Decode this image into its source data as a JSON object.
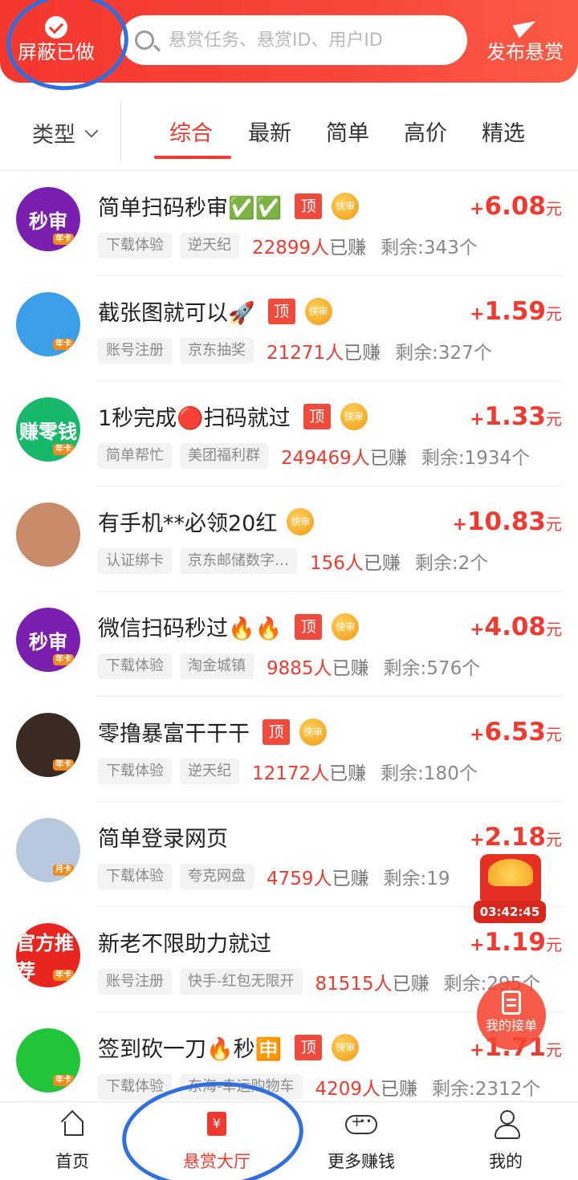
{
  "header": {
    "hide_done_label": "屏蔽已做",
    "search_placeholder": "悬赏任务、悬赏ID、用户ID",
    "publish_label": "发布悬赏"
  },
  "filters": {
    "type_label": "类型",
    "tabs": [
      "综合",
      "最新",
      "简单",
      "高价",
      "精选"
    ],
    "active_tab": "综合"
  },
  "badges": {
    "top": "顶",
    "fast": "快审",
    "unit": "元",
    "plus": "+"
  },
  "tasks": [
    {
      "title": "简单扫码秒审✅✅",
      "top": true,
      "fast": true,
      "price": "6.08",
      "tags": [
        "下载体验",
        "逆天纪"
      ],
      "earned_num": "22899人",
      "earned_txt": "已赚",
      "remaining": "剩余:343个",
      "avatar_text": "秒审",
      "avatar_color": "#7a1fb0",
      "card": "年卡"
    },
    {
      "title": "截张图就可以🚀",
      "top": true,
      "fast": true,
      "price": "1.59",
      "tags": [
        "账号注册",
        "京东抽奖"
      ],
      "earned_num": "21271人",
      "earned_txt": "已赚",
      "remaining": "剩余:327个",
      "avatar_text": "",
      "avatar_color": "#3a9ee8",
      "card": "年卡"
    },
    {
      "title": "1秒完成🔴扫码就过",
      "top": true,
      "fast": true,
      "price": "1.33",
      "tags": [
        "简单帮忙",
        "美团福利群"
      ],
      "earned_num": "249469人",
      "earned_txt": "已赚",
      "remaining": "剩余:1934个",
      "avatar_text": "赚零钱",
      "avatar_color": "#17b86a",
      "card": "年卡"
    },
    {
      "title": "有手机**必领20红",
      "top": false,
      "fast": true,
      "price": "10.83",
      "tags": [
        "认证绑卡",
        "京东邮储数字…"
      ],
      "earned_num": "156人",
      "earned_txt": "已赚",
      "remaining": "剩余:2个",
      "avatar_text": "",
      "avatar_color": "#c98a6a",
      "card": ""
    },
    {
      "title": "微信扫码秒过🔥🔥",
      "top": true,
      "fast": true,
      "price": "4.08",
      "tags": [
        "下载体验",
        "淘金城镇"
      ],
      "earned_num": "9885人",
      "earned_txt": "已赚",
      "remaining": "剩余:576个",
      "avatar_text": "秒审",
      "avatar_color": "#7a1fb0",
      "card": "年卡"
    },
    {
      "title": "零撸暴富干干干",
      "top": true,
      "fast": true,
      "price": "6.53",
      "tags": [
        "下载体验",
        "逆天纪"
      ],
      "earned_num": "12172人",
      "earned_txt": "已赚",
      "remaining": "剩余:180个",
      "avatar_text": "",
      "avatar_color": "#3b2a22",
      "card": "年卡"
    },
    {
      "title": "简单登录网页",
      "top": false,
      "fast": false,
      "price": "2.18",
      "tags": [
        "下载体验",
        "夸克网盘"
      ],
      "earned_num": "4759人",
      "earned_txt": "已赚",
      "remaining": "剩余:19",
      "avatar_text": "",
      "avatar_color": "#b9c9dd",
      "card": "月卡"
    },
    {
      "title": "新老不限助力就过",
      "top": false,
      "fast": false,
      "price": "1.19",
      "tags": [
        "账号注册",
        "快手-红包无限开"
      ],
      "earned_num": "81515人",
      "earned_txt": "已赚",
      "remaining": "剩余:295个",
      "avatar_text": "官方推荐",
      "avatar_color": "#e8261f",
      "card": "年卡"
    },
    {
      "title": "签到砍一刀🔥秒🈸",
      "top": true,
      "fast": true,
      "price": "1.71",
      "tags": [
        "下载体验",
        "东海-幸运购物车"
      ],
      "earned_num": "4209人",
      "earned_txt": "已赚",
      "remaining": "剩余:2312个",
      "avatar_text": "",
      "avatar_color": "#22c43a",
      "card": "年卡"
    }
  ],
  "floating": {
    "countdown": "03:42:45",
    "my_orders_label": "我的接单"
  },
  "nav": {
    "items": [
      "首页",
      "悬赏大厅",
      "更多赚钱",
      "我的"
    ],
    "active": "悬赏大厅",
    "hall_icon_glyph": "¥"
  },
  "colors": {
    "accent": "#f03a30",
    "annotation": "#2f6fe0"
  }
}
